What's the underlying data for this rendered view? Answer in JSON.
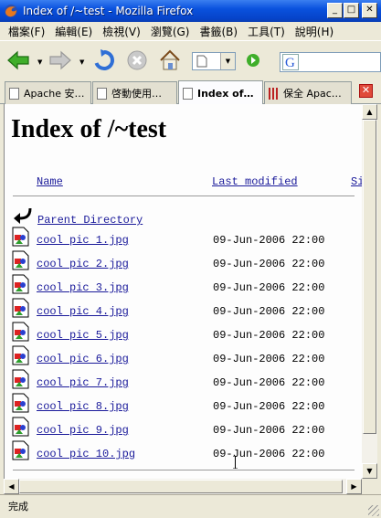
{
  "window": {
    "title": "Index of /~test - Mozilla Firefox",
    "controls": {
      "minimize": "_",
      "maximize": "□",
      "close": "✕"
    }
  },
  "menu": [
    "檔案(F)",
    "編輯(E)",
    "檢視(V)",
    "瀏覽(G)",
    "書籤(B)",
    "工具(T)",
    "說明(H)"
  ],
  "toolbar": {
    "back_icon": "back-arrow-icon",
    "forward_icon": "forward-arrow-icon",
    "reload_icon": "reload-icon",
    "stop_icon": "stop-icon",
    "home_icon": "home-icon",
    "go_icon": "go-icon",
    "search_engine_icon": "google-icon"
  },
  "tabs": [
    {
      "label": "Apache 安…",
      "active": false
    },
    {
      "label": "啓動使用…",
      "active": false
    },
    {
      "label": "Index of…",
      "active": true
    },
    {
      "label": "保全 Apac…",
      "active": false
    }
  ],
  "page": {
    "title": "Index of /~test",
    "columns": {
      "name": "Name",
      "modified": "Last modified",
      "size": "Si"
    },
    "parent_label": "Parent Directory",
    "files": [
      {
        "name": "cool pic 1.jpg",
        "modified": "09-Jun-2006 22:00"
      },
      {
        "name": "cool pic 2.jpg",
        "modified": "09-Jun-2006 22:00"
      },
      {
        "name": "cool pic 3.jpg",
        "modified": "09-Jun-2006 22:00"
      },
      {
        "name": "cool pic 4.jpg",
        "modified": "09-Jun-2006 22:00"
      },
      {
        "name": "cool pic 5.jpg",
        "modified": "09-Jun-2006 22:00"
      },
      {
        "name": "cool pic 6.jpg",
        "modified": "09-Jun-2006 22:00"
      },
      {
        "name": "cool pic 7.jpg",
        "modified": "09-Jun-2006 22:00"
      },
      {
        "name": "cool pic 8.jpg",
        "modified": "09-Jun-2006 22:00"
      },
      {
        "name": "cool pic 9.jpg",
        "modified": "09-Jun-2006 22:00"
      },
      {
        "name": "cool pic 10.jpg",
        "modified": "09-Jun-2006 22:00"
      }
    ]
  },
  "status": {
    "text": "完成"
  },
  "colors": {
    "titlebar": "#0a52de",
    "link": "#1a1a9a",
    "chrome": "#ece9d8"
  }
}
